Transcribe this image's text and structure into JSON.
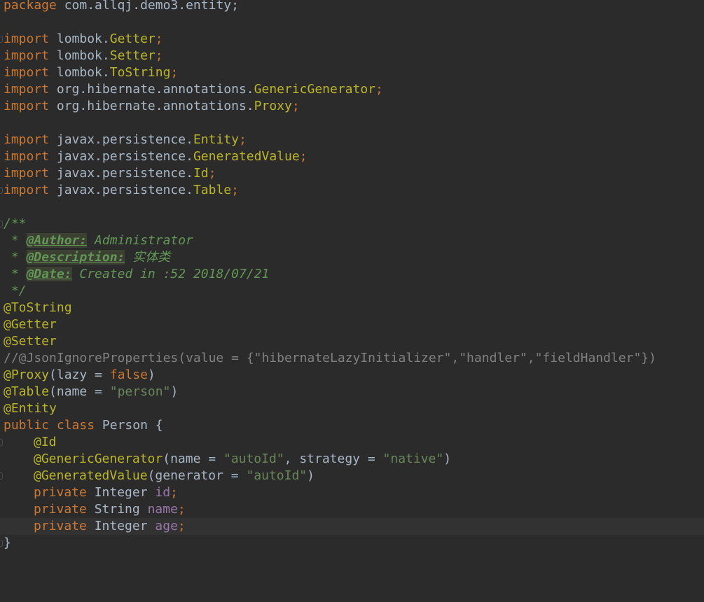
{
  "code": {
    "package_kw": "package",
    "package_name": "com.allqj.demo3.entity;",
    "import_kw": "import",
    "imports": [
      {
        "pkg": "lombok.",
        "cls": "Getter",
        "end": ";"
      },
      {
        "pkg": "lombok.",
        "cls": "Setter",
        "end": ";"
      },
      {
        "pkg": "lombok.",
        "cls": "ToString",
        "end": ";"
      },
      {
        "pkg": "org.hibernate.annotations.",
        "cls": "GenericGenerator",
        "end": ";"
      },
      {
        "pkg": "org.hibernate.annotations.",
        "cls": "Proxy",
        "end": ";"
      },
      {
        "pkg": "javax.persistence.",
        "cls": "Entity",
        "end": ";"
      },
      {
        "pkg": "javax.persistence.",
        "cls": "GeneratedValue",
        "end": ";"
      },
      {
        "pkg": "javax.persistence.",
        "cls": "Id",
        "end": ";"
      },
      {
        "pkg": "javax.persistence.",
        "cls": "Table",
        "end": ";"
      }
    ],
    "javadoc": {
      "open": "/**",
      "prefix": " * ",
      "author_tag": "@Author:",
      "author_value": " Administrator",
      "description_tag": "@Description:",
      "description_value": " 实体类",
      "date_tag": "@Date:",
      "date_value": " Created in :52 2018/07/21",
      "close": " */"
    },
    "annotations": {
      "tostring": "@ToString",
      "getter": "@Getter",
      "setter": "@Setter",
      "json_comment": "//@JsonIgnoreProperties(value = {\"hibernateLazyInitializer\",\"handler\",\"fieldHandler\"})",
      "proxy": "@Proxy",
      "proxy_args_open": "(lazy = ",
      "proxy_false": "false",
      "proxy_close": ")",
      "table": "@Table",
      "table_args_open": "(name = ",
      "table_name": "\"person\"",
      "table_close": ")",
      "entity": "@Entity"
    },
    "class_decl": {
      "public_kw": "public",
      "class_kw": "class",
      "name": " Person {"
    },
    "members": {
      "id_ann": "@Id",
      "gen_ann": "@GenericGenerator",
      "gen_open": "(name = ",
      "gen_name": "\"autoId\"",
      "gen_mid": ", strategy = ",
      "gen_strategy": "\"native\"",
      "gen_close": ")",
      "genval_ann": "@GeneratedValue",
      "genval_open": "(generator = ",
      "genval_value": "\"autoId\"",
      "genval_close": ")",
      "private_kw": "private",
      "fields": [
        {
          "type": " Integer ",
          "name": "id",
          "end": ";"
        },
        {
          "type": " String ",
          "name": "name",
          "end": ";"
        },
        {
          "type": " Integer ",
          "name": "age",
          "end": ";"
        }
      ]
    },
    "closing_brace": "}"
  }
}
